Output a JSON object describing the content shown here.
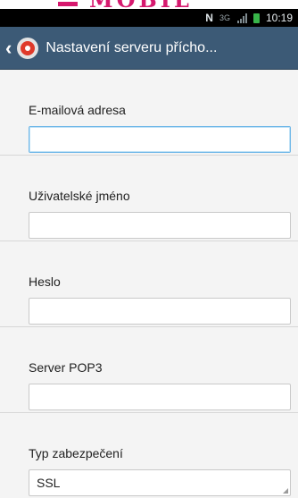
{
  "status_bar": {
    "nfc_label": "N",
    "data_label": "3G",
    "time": "10:19"
  },
  "action_bar": {
    "title": "Nastavení serveru přícho..."
  },
  "form": {
    "fields": [
      {
        "label": "E-mailová adresa",
        "value": "",
        "placeholder": ""
      },
      {
        "label": "Uživatelské jméno",
        "value": "",
        "placeholder": ""
      },
      {
        "label": "Heslo",
        "value": "",
        "placeholder": ""
      },
      {
        "label": "Server POP3",
        "value": "",
        "placeholder": ""
      }
    ],
    "security": {
      "label": "Typ zabezpečení",
      "value": "SSL"
    }
  },
  "colors": {
    "action_bar": "#3c5a76",
    "brand": "#d6196e",
    "battery": "#38b54a",
    "focus": "#6fb7e8"
  },
  "icons": [
    "nfc-icon",
    "data-icon",
    "signal-icon",
    "battery-icon",
    "back-chevron-icon",
    "email-app-icon"
  ]
}
